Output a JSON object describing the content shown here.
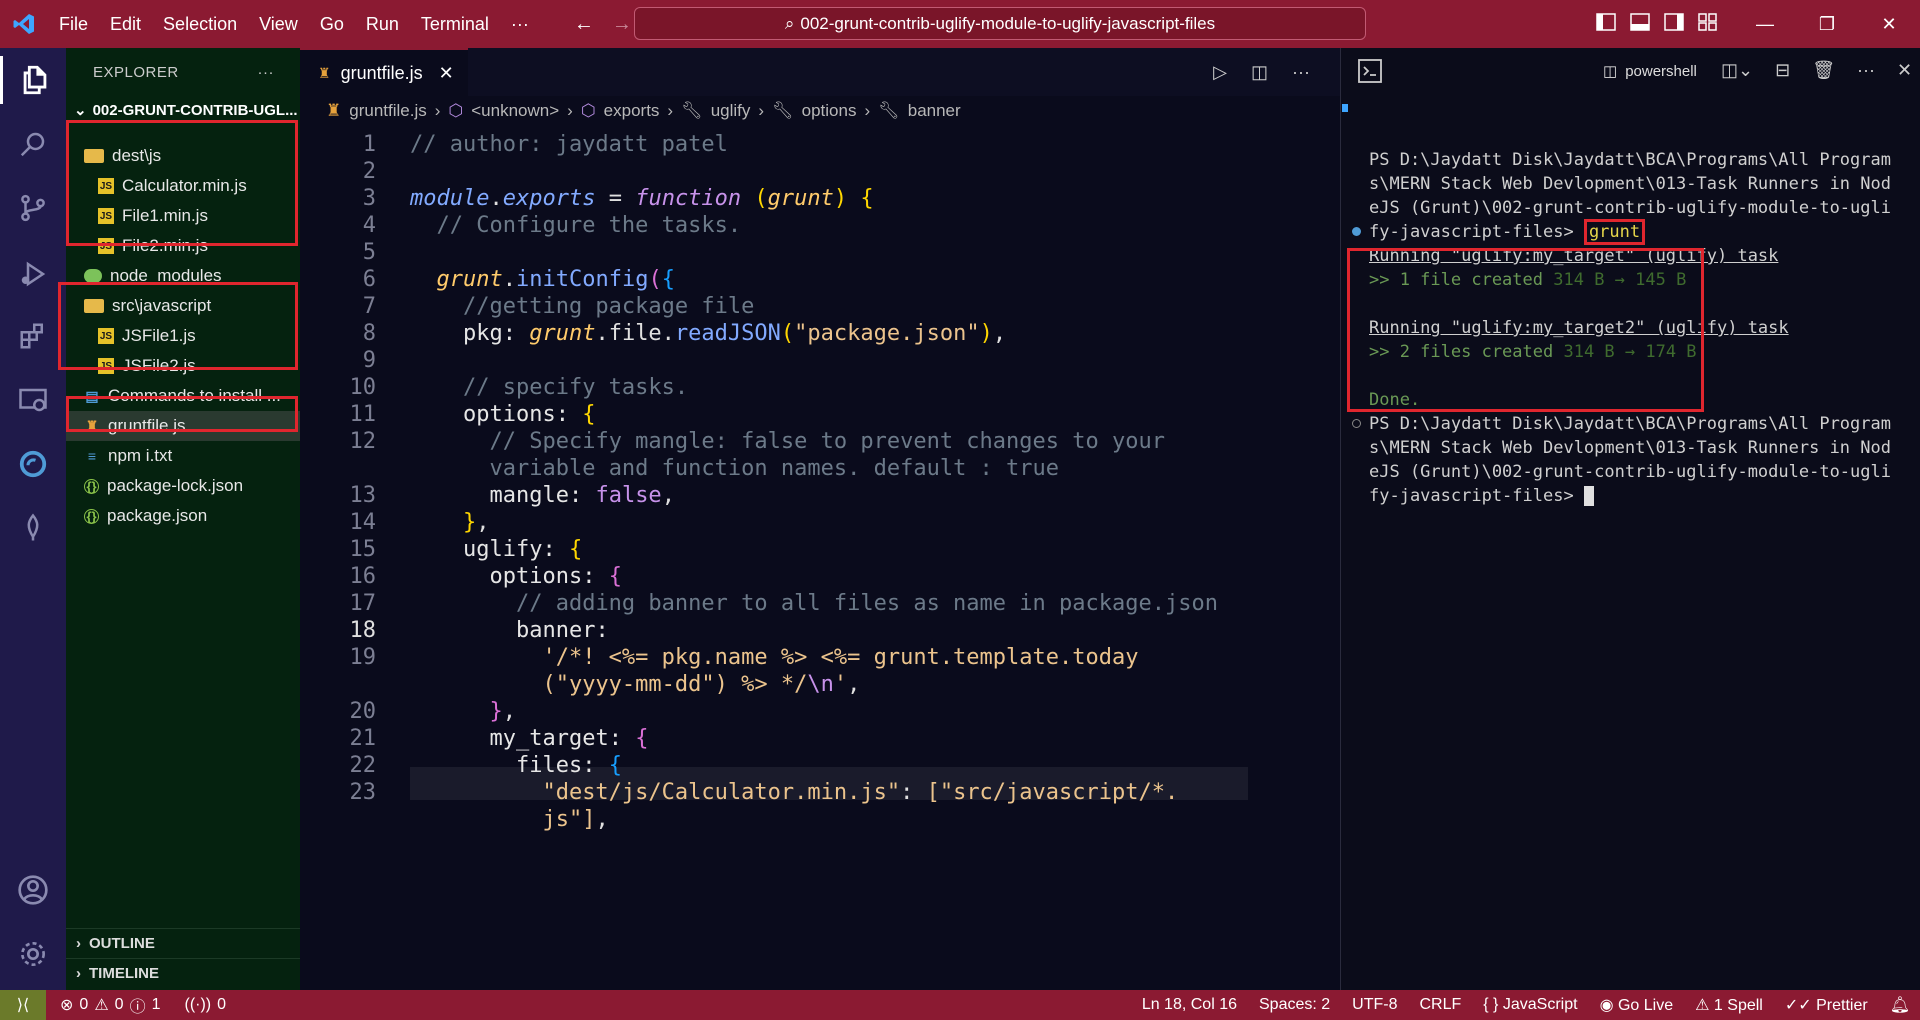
{
  "titlebar": {
    "menu": [
      "File",
      "Edit",
      "Selection",
      "View",
      "Go",
      "Run",
      "Terminal",
      "···"
    ],
    "search": "002-grunt-contrib-uglify-module-to-uglify-javascript-files"
  },
  "explorer": {
    "title": "EXPLORER",
    "more": "···",
    "root": "002-GRUNT-CONTRIB-UGL...",
    "items": [
      {
        "label": "dest\\js",
        "icon": "folder-open-icon"
      },
      {
        "label": "Calculator.min.js",
        "icon": "js-icon"
      },
      {
        "label": "File1.min.js",
        "icon": "js-icon"
      },
      {
        "label": "File2.min.js",
        "icon": "js-icon"
      },
      {
        "label": "node_modules",
        "icon": "node-modules-icon"
      },
      {
        "label": "src\\javascript",
        "icon": "folder-open-icon"
      },
      {
        "label": "JSFile1.js",
        "icon": "js-icon"
      },
      {
        "label": "JSFile2.js",
        "icon": "js-icon"
      },
      {
        "label": "Commands to install ...",
        "icon": "markdown-icon"
      },
      {
        "label": "gruntfile.js",
        "icon": "grunt-icon"
      },
      {
        "label": "npm i.txt",
        "icon": "text-file-icon"
      },
      {
        "label": "package-lock.json",
        "icon": "json-icon"
      },
      {
        "label": "package.json",
        "icon": "json-icon"
      }
    ],
    "outline": "OUTLINE",
    "timeline": "TIMELINE"
  },
  "editor": {
    "tab": "gruntfile.js",
    "breadcrumb": [
      "gruntfile.js",
      "<unknown>",
      "exports",
      "uglify",
      "options",
      "banner"
    ],
    "line_numbers": [
      "1",
      "2",
      "3",
      "4",
      "5",
      "6",
      "7",
      "8",
      "9",
      "10",
      "11",
      "12",
      "",
      "13",
      "14",
      "15",
      "16",
      "17",
      "18",
      "19",
      "",
      "20",
      "21",
      "22",
      "23",
      ""
    ]
  },
  "terminal": {
    "shell": "powershell",
    "prompt1": [
      "PS D:\\Jaydatt Disk\\Jaydatt\\BCA\\Programs\\All Program",
      "s\\MERN Stack Web Devlopment\\013-Task Runners in Nod",
      "eJS (Grunt)\\002-grunt-contrib-uglify-module-to-ugli",
      "fy-javascript-files> "
    ],
    "command": "grunt",
    "task1": "Running \"uglify:my_target\" (uglify) task",
    "task1_result": ">> 1 file created",
    "task1_sizes": "314 B → 145 B",
    "task2": "Running \"uglify:my_target2\" (uglify) task",
    "task2_result": ">> 2 files created",
    "task2_sizes": "314 B → 174 B",
    "done": "Done.",
    "prompt2": [
      "PS D:\\Jaydatt Disk\\Jaydatt\\BCA\\Programs\\All Program",
      "s\\MERN Stack Web Devlopment\\013-Task Runners in Nod",
      "eJS (Grunt)\\002-grunt-contrib-uglify-module-to-ugli",
      "fy-javascript-files> "
    ]
  },
  "statusbar": {
    "errors": "0",
    "warnings": "0",
    "info": "1",
    "ports": "0",
    "position": "Ln 18, Col 16",
    "spaces": "Spaces: 2",
    "encoding": "UTF-8",
    "eol": "CRLF",
    "language": "JavaScript",
    "golive": "Go Live",
    "spell": "1 Spell",
    "prettier": "Prettier"
  }
}
